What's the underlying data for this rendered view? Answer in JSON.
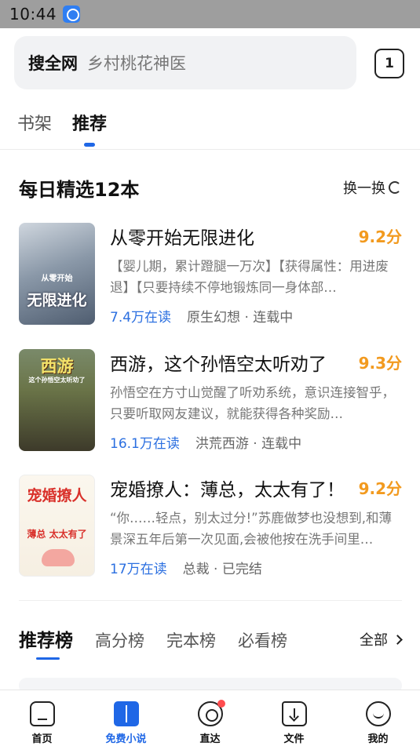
{
  "status_bar": {
    "time": "10:44"
  },
  "search": {
    "prefix": "搜全网",
    "query": "乡村桃花神医"
  },
  "tab_count": "1",
  "top_tabs": [
    {
      "label": "书架"
    },
    {
      "label": "推荐",
      "active": true
    }
  ],
  "daily": {
    "title": "每日精选12本",
    "refresh_label": "换一换"
  },
  "books": [
    {
      "title": "从零开始无限进化",
      "score": "9.2分",
      "desc": "【婴儿期，累计蹬腿一万次】【获得属性：用进废退】【只要持续不停地锻炼同一身体部…",
      "readers": "7.4万在读",
      "tags": "原生幻想 · 连载中",
      "cover_text": "无限进化",
      "cover_top": "从零开始"
    },
    {
      "title": "西游，这个孙悟空太听劝了",
      "score": "9.3分",
      "desc": "孙悟空在方寸山觉醒了听劝系统，意识连接智乎，只要听取网友建议，就能获得各种奖励…",
      "readers": "16.1万在读",
      "tags": "洪荒西游 · 连载中",
      "cover_text": "西游",
      "cover_top": "这个孙悟空太听劝了"
    },
    {
      "title": "宠婚撩人：薄总，太太有了！",
      "score": "9.2分",
      "desc": "“你……轻点，别太过分!”苏鹿做梦也没想到,和薄景深五年后第一次见面,会被他按在洗手间里…",
      "readers": "17万在读",
      "tags": "总裁 · 已完结",
      "cover_text": "宠婚撩人",
      "cover_top": "薄总 太太有了"
    }
  ],
  "ranking": {
    "tabs": [
      {
        "label": "推荐榜",
        "active": true
      },
      {
        "label": "高分榜"
      },
      {
        "label": "完本榜"
      },
      {
        "label": "必看榜"
      }
    ],
    "all_label": "全部"
  },
  "bottom_nav": [
    {
      "label": "首页",
      "icon": "home-icon"
    },
    {
      "label": "免费小说",
      "icon": "book-icon",
      "active": true
    },
    {
      "label": "直达",
      "icon": "compass-icon",
      "badge": true
    },
    {
      "label": "文件",
      "icon": "file-download-icon"
    },
    {
      "label": "我的",
      "icon": "smile-icon"
    }
  ],
  "colors": {
    "accent": "#1f67e6",
    "score": "#f29a1f",
    "readers": "#2b6fe0",
    "badge": "#ff4d4f"
  }
}
